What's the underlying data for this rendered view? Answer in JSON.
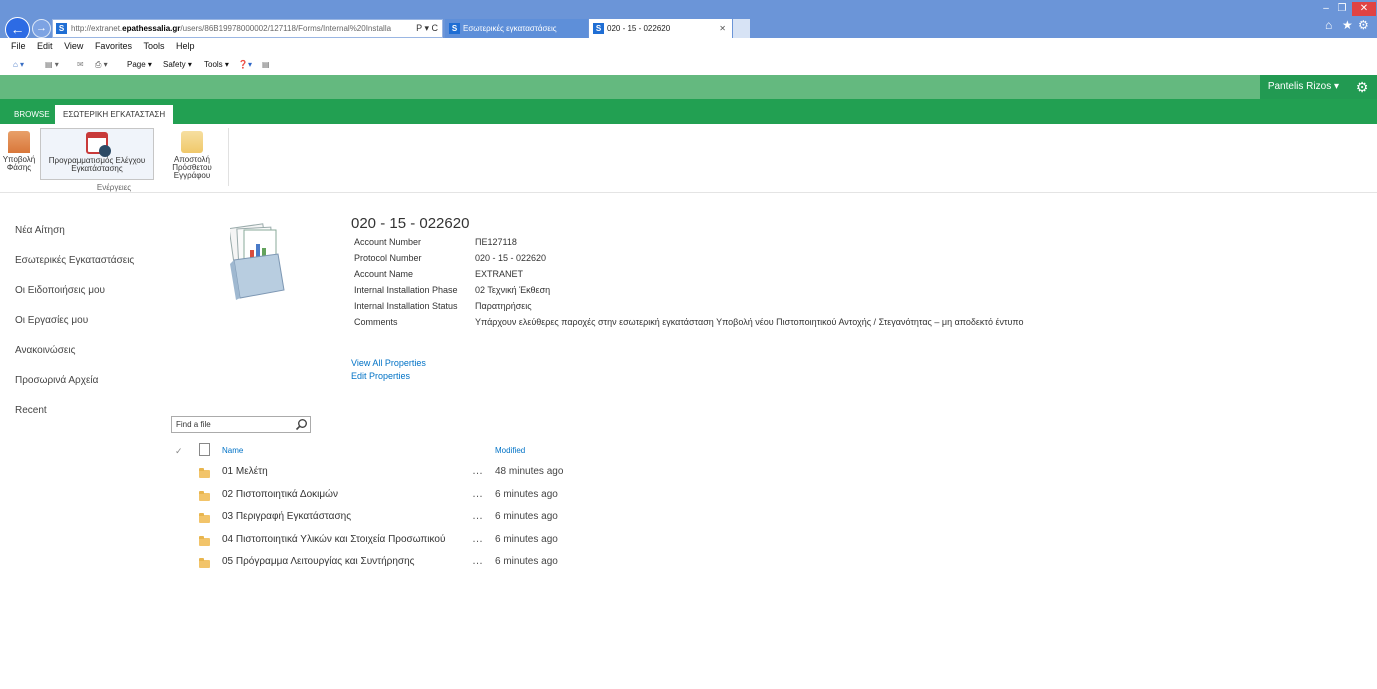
{
  "browser": {
    "address_url_prefix": "http://extranet.",
    "address_url_domain": "epathessalia.gr",
    "address_url_rest": "/users/86B19978000002/127118/Forms/Internal%20Installa",
    "address_controls": "Ρ ▾ C",
    "tabs": [
      {
        "label": "Εσωτερικές εγκαταστάσεις",
        "active": false
      },
      {
        "label": "020 - 15 - 022620",
        "active": true
      }
    ],
    "menu": [
      "File",
      "Edit",
      "View",
      "Favorites",
      "Tools",
      "Help"
    ],
    "commands": {
      "page": "Page ▾",
      "safety": "Safety ▾",
      "tools": "Tools ▾"
    }
  },
  "suite": {
    "user": "Pantelis Rizos ▾"
  },
  "ribbon": {
    "tabs": {
      "browse": "BROWSE",
      "active": "ΕΣΩΤΕΡΙΚΗ ΕΓΚΑΤΑΣΤΑΣΗ"
    },
    "buttons": [
      {
        "line1": "Υποβολή",
        "line2": "Φάσης"
      },
      {
        "line1": "Προγραμματισμός Ελέγχου",
        "line2": "Εγκατάστασης"
      },
      {
        "line1": "Αποστολή Πρόσθετου",
        "line2": "Εγγράφου"
      }
    ],
    "group_label": "Ενέργειες"
  },
  "left_nav": [
    "Νέα Αίτηση",
    "Εσωτερικές Εγκαταστάσεις",
    "Οι Ειδοποιήσεις μου",
    "Οι Εργασίες μου",
    "Ανακοινώσεις",
    "Προσωρινά Αρχεία",
    "Recent"
  ],
  "docset": {
    "title": "020 - 15 - 022620",
    "properties": [
      {
        "label": "Account Number",
        "value": "ΠΕ127118"
      },
      {
        "label": "Protocol Number",
        "value": "020 - 15 - 022620"
      },
      {
        "label": "Account Name",
        "value": "EXTRANET"
      },
      {
        "label": "Internal Installation Phase",
        "value": "02 Τεχνική Έκθεση"
      },
      {
        "label": "Internal Installation Status",
        "value": "Παρατηρήσεις"
      },
      {
        "label": "Comments",
        "value": "Υπάρχουν ελεύθερες παροχές στην εσωτερική εγκατάσταση Υποβολή νέου Πιστοποιητικού Αντοχής / Στεγανότητας – μη αποδεκτό έντυπο"
      }
    ],
    "view_all": "View All Properties",
    "edit": "Edit Properties"
  },
  "library": {
    "search_placeholder": "Find a file",
    "col_name": "Name",
    "col_modified": "Modified",
    "ellipsis": "…",
    "folders": [
      {
        "name": "01 Μελέτη",
        "modified": "48 minutes ago"
      },
      {
        "name": "02 Πιστοποιητικά Δοκιμών",
        "modified": "6 minutes ago"
      },
      {
        "name": "03 Περιγραφή Εγκατάστασης",
        "modified": "6 minutes ago"
      },
      {
        "name": "04 Πιστοποιητικά Υλικών και Στοιχεία Προσωπικού",
        "modified": "6 minutes ago"
      },
      {
        "name": "05 Πρόγραμμα Λειτουργίας και Συντήρησης",
        "modified": "6 minutes ago"
      }
    ]
  },
  "icons": {
    "back": "back-arrow-icon",
    "forward": "forward-arrow-icon",
    "home": "home-icon",
    "favorites": "star-icon",
    "tools": "gear-icon",
    "settings": "gear-icon",
    "search": "search-icon",
    "folder": "folder-icon",
    "document": "document-icon"
  },
  "colors": {
    "suite": "#64b97f",
    "ribbon_tabs": "#22a052",
    "user_button": "#229a52",
    "browser_chrome": "#6b95d8",
    "link": "#0072c6"
  }
}
